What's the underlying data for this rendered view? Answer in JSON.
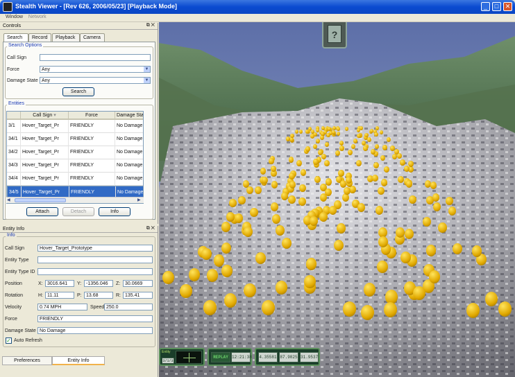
{
  "window": {
    "title": "Stealth Viewer - [Rev 626, 2006/05/23] [Playback Mode]",
    "minimize": "_",
    "maximize": "□",
    "close": "✕"
  },
  "menu": [
    "Window",
    "Network"
  ],
  "controls": {
    "title": "Controls",
    "icons": "⧉ ✕",
    "tabs": [
      "Search",
      "Record",
      "Playback",
      "Camera"
    ],
    "search_options": {
      "label": "Search Options",
      "callsign_label": "Call Sign",
      "callsign_value": "",
      "force_label": "Force",
      "force_value": "Any",
      "damage_label": "Damage State",
      "damage_value": "Any",
      "search_button": "Search"
    },
    "entities": {
      "label": "Entities",
      "columns": [
        "",
        "Call Sign",
        "Force",
        "Damage Sta"
      ],
      "rows": [
        [
          "3/1",
          "Hover_Target_Pr",
          "FRIENDLY",
          "No Damage"
        ],
        [
          "34/1",
          "Hover_Target_Pr",
          "FRIENDLY",
          "No Damage"
        ],
        [
          "34/2",
          "Hover_Target_Pr",
          "FRIENDLY",
          "No Damage"
        ],
        [
          "34/3",
          "Hover_Target_Pr",
          "FRIENDLY",
          "No Damage"
        ],
        [
          "34/4",
          "Hover_Target_Pr",
          "FRIENDLY",
          "No Damage"
        ],
        [
          "34/5",
          "Hover_Target_Pr",
          "FRIENDLY",
          "No Damage"
        ]
      ],
      "selected_row": 5,
      "attach": "Attach",
      "detach": "Detach",
      "info": "Info"
    }
  },
  "entity_info": {
    "title": "Entity Info",
    "icons": "⧉ ✕",
    "group": "Info",
    "callsign_label": "Call Sign",
    "callsign_value": "Hover_Target_Prototype",
    "entity_type_label": "Entity Type",
    "entity_type_value": "",
    "entity_type_id_label": "Entity Type ID",
    "entity_type_id_value": "",
    "position_label": "Position",
    "pos_x_label": "X:",
    "pos_x": "3016.641",
    "pos_y_label": "Y:",
    "pos_y": "-1356.046",
    "pos_z_label": "Z:",
    "pos_z": "30.0669",
    "rotation_label": "Rotation",
    "rot_h_label": "H:",
    "rot_h": "11.11",
    "rot_p_label": "P:",
    "rot_p": "13.68",
    "rot_r_label": "R:",
    "rot_r": "135.41",
    "velocity_label": "Velocity",
    "velocity_value": "0.74 MPH",
    "speed_label": "Speed:",
    "speed_value": "250.0",
    "force_label": "Force",
    "force_value": "FRIENDLY",
    "damage_label": "Damage State",
    "damage_value": "No Damage",
    "auto_refresh": "Auto Refresh",
    "auto_refresh_checked": true
  },
  "bottom_tabs": [
    "Preferences",
    "Entity Info"
  ],
  "hud": {
    "help": "?",
    "entity_label": "Entity",
    "entity_value": "3/1/3",
    "replay": "REPLAY",
    "time": "12:21:38",
    "lat": "4.35581",
    "lon": "87.9825",
    "elev": "31.9537"
  }
}
